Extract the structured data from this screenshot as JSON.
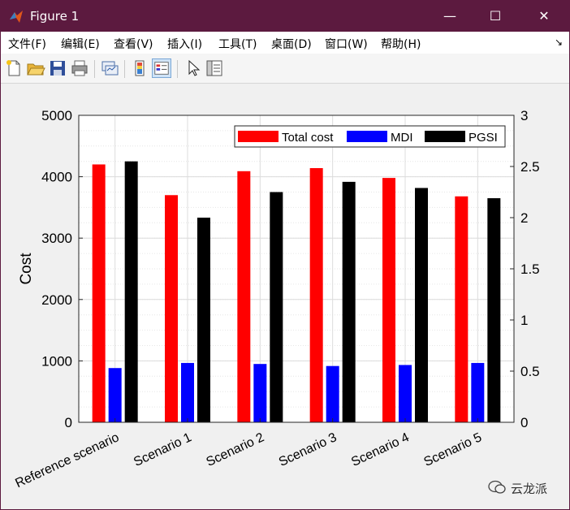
{
  "window": {
    "title": "Figure 1",
    "controls": {
      "minimize": "—",
      "maximize": "☐",
      "close": "✕"
    }
  },
  "menu": {
    "items": [
      "文件(F)",
      "编辑(E)",
      "查看(V)",
      "插入(I)",
      "工具(T)",
      "桌面(D)",
      "窗口(W)",
      "帮助(H)"
    ],
    "arrow": "↘"
  },
  "toolbar": {
    "icons": [
      "new-figure-icon",
      "open-file-icon",
      "save-icon",
      "print-icon",
      "link-plot-icon",
      "colorbar-icon",
      "legend-icon",
      "select-pointer-icon",
      "property-inspector-icon"
    ]
  },
  "watermark": {
    "text": "云龙派"
  },
  "chart_data": {
    "type": "bar",
    "categories": [
      "Reference scenario",
      "Scenario 1",
      "Scenario 2",
      "Scenario 3",
      "Scenario 4",
      "Scenario 5"
    ],
    "series": [
      {
        "name": "Total cost",
        "axis": "left",
        "color": "#ff0000",
        "values": [
          4200,
          3700,
          4090,
          4140,
          3980,
          3680
        ]
      },
      {
        "name": "MDI",
        "axis": "right",
        "color": "#0000ff",
        "values": [
          0.53,
          0.58,
          0.57,
          0.55,
          0.56,
          0.58
        ]
      },
      {
        "name": "PGSI",
        "axis": "right",
        "color": "#000000",
        "values": [
          2.55,
          2.0,
          2.25,
          2.35,
          2.29,
          2.19
        ]
      }
    ],
    "ylabel": "Cost",
    "ylim": [
      0,
      5000
    ],
    "y_ticks": [
      "0",
      "1000",
      "2000",
      "3000",
      "4000",
      "5000"
    ],
    "y2lim": [
      0,
      3
    ],
    "y2_ticks": [
      "0",
      "0.5",
      "1",
      "1.5",
      "2",
      "2.5",
      "3"
    ],
    "grid": true,
    "minor_grid": true,
    "legend_position": "top-right",
    "legend_orientation": "horizontal"
  }
}
